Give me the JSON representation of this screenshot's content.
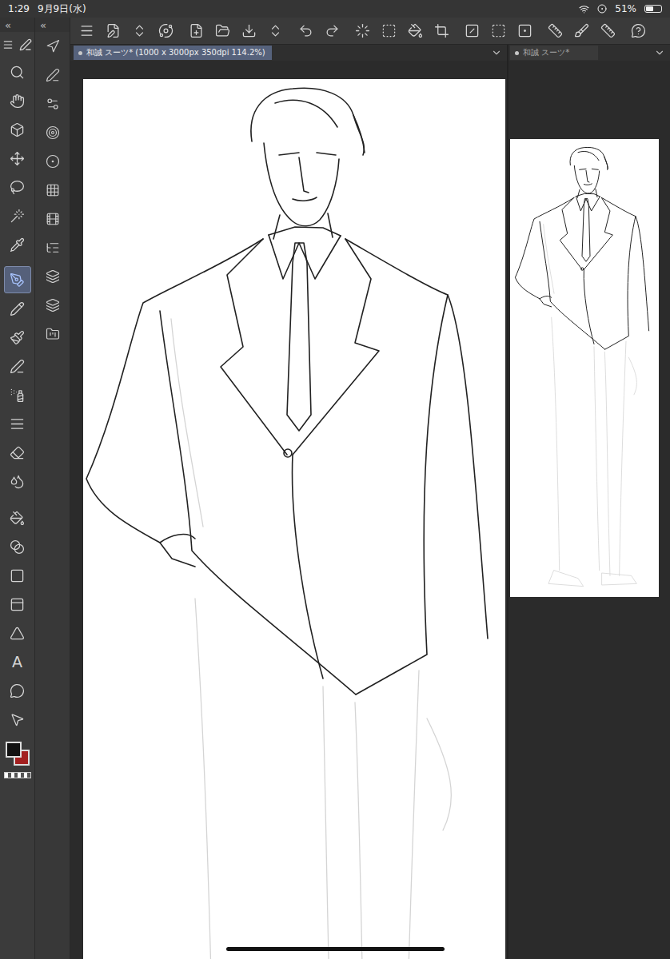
{
  "status_bar": {
    "time": "1:29",
    "date": "9月9日(水)",
    "battery": "51%",
    "battery_level": 0.51
  },
  "rail": {
    "collapse_glyph": "«"
  },
  "sub_rail": {
    "collapse_glyph": "«"
  },
  "tool_groups": [
    {
      "tools": [
        {
          "name": "zoom",
          "kind": "icon",
          "selected": false
        },
        {
          "name": "hand",
          "kind": "icon",
          "selected": false
        },
        {
          "name": "object",
          "kind": "icon",
          "selected": false
        },
        {
          "name": "move",
          "kind": "icon",
          "selected": false
        },
        {
          "name": "lasso",
          "kind": "icon",
          "selected": false
        },
        {
          "name": "wand",
          "kind": "icon",
          "selected": false
        },
        {
          "name": "eyedropper",
          "kind": "icon",
          "selected": false
        }
      ]
    },
    {
      "tools": [
        {
          "name": "pen",
          "kind": "icon",
          "selected": true
        },
        {
          "name": "pencil",
          "kind": "icon",
          "selected": false
        },
        {
          "name": "brush",
          "kind": "icon",
          "selected": false
        },
        {
          "name": "airbrush",
          "kind": "icon",
          "selected": false
        },
        {
          "name": "decoration",
          "kind": "icon",
          "selected": false
        },
        {
          "name": "lines",
          "kind": "icon",
          "selected": false
        },
        {
          "name": "eraser",
          "kind": "icon",
          "selected": false
        },
        {
          "name": "blend",
          "kind": "icon",
          "selected": false
        }
      ]
    },
    {
      "tools": [
        {
          "name": "fill",
          "kind": "icon",
          "selected": false
        },
        {
          "name": "gradient",
          "kind": "icon",
          "selected": false
        },
        {
          "name": "figure",
          "kind": "icon",
          "selected": false
        },
        {
          "name": "frame",
          "kind": "icon",
          "selected": false
        },
        {
          "name": "ruler",
          "kind": "icon",
          "selected": false
        },
        {
          "name": "text",
          "kind": "glyph",
          "glyph": "A",
          "selected": false
        },
        {
          "name": "balloon",
          "kind": "icon",
          "selected": false
        },
        {
          "name": "correct-line",
          "kind": "icon",
          "selected": false
        }
      ]
    }
  ],
  "colors": {
    "main": "#111111",
    "sub": "#a32020"
  },
  "sub_tools": [
    "navigator",
    "tool-property",
    "brush-size",
    "sub-tool",
    "color-circle",
    "color-set",
    "animation",
    "layer-property",
    "layer-search",
    "layers",
    "materials"
  ],
  "command_groups": [
    [
      "menu",
      "modify",
      "switch",
      "quick-access"
    ],
    [
      "new",
      "open",
      "save",
      "switch-2"
    ],
    [
      "undo",
      "redo"
    ],
    [
      "clear",
      "clear-outside",
      "fill-cmd",
      "transform"
    ],
    [
      "deselect",
      "invert",
      "border"
    ],
    [
      "ruler-snap",
      "brush-snap",
      "ruler-toggle"
    ],
    [
      "help"
    ]
  ],
  "document_tab": {
    "label": "和誠 スーツ* (1000 x 3000px 350dpi 114.2%)",
    "selected": true
  },
  "navigator": {
    "title": "和誠 スーツ*"
  }
}
